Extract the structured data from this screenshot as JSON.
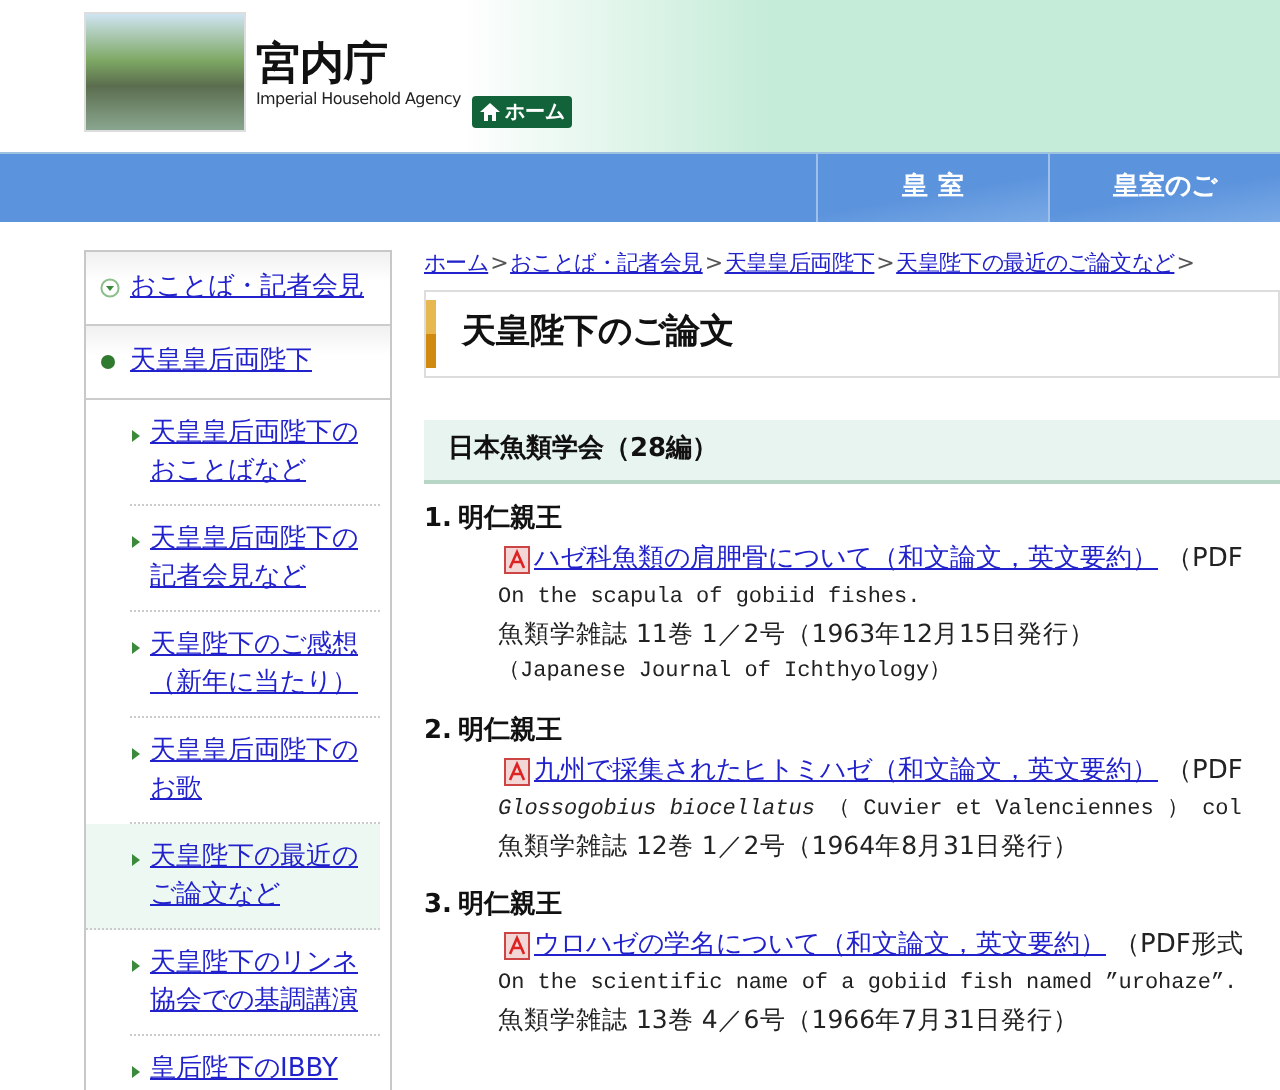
{
  "header": {
    "title_ja": "宮内庁",
    "title_en": "Imperial Household Agency",
    "home_button": "ホーム"
  },
  "nav_tabs": [
    {
      "label": "皇 室"
    },
    {
      "label": "皇室のご"
    }
  ],
  "sidebar": {
    "items": [
      {
        "label": "おことば・記者会見",
        "kind": "collapsible",
        "selected": false
      },
      {
        "label": "天皇皇后両陛下",
        "kind": "current",
        "selected": false
      },
      {
        "label": "天皇皇后両陛下のおことばなど",
        "kind": "sub",
        "selected": false
      },
      {
        "label": "天皇皇后両陛下の記者会見など",
        "kind": "sub",
        "selected": false
      },
      {
        "label": "天皇陛下のご感想（新年に当たり）",
        "kind": "sub",
        "selected": false
      },
      {
        "label": "天皇皇后両陛下のお歌",
        "kind": "sub",
        "selected": false
      },
      {
        "label": "天皇陛下の最近のご論文など",
        "kind": "sub",
        "selected": true
      },
      {
        "label": "天皇陛下のリンネ協会での基調講演",
        "kind": "sub",
        "selected": false
      },
      {
        "label": "皇后陛下のIBBY",
        "kind": "sub",
        "selected": false
      }
    ]
  },
  "breadcrumb": [
    {
      "kind": "link",
      "label": "ホーム"
    },
    {
      "kind": "separator",
      "label": ">"
    },
    {
      "kind": "link",
      "label": "おことば・記者会見"
    },
    {
      "kind": "separator",
      "label": ">"
    },
    {
      "kind": "link",
      "label": "天皇皇后両陛下"
    },
    {
      "kind": "separator",
      "label": ">"
    },
    {
      "kind": "link",
      "label": "天皇陛下の最近のご論文など"
    },
    {
      "kind": "separator",
      "label": ">"
    }
  ],
  "page_title": "天皇陛下のご論文",
  "section_title": "日本魚類学会（28編）",
  "papers": [
    {
      "number": "1.",
      "author": "明仁親王",
      "link": "ハゼ科魚類の肩胛骨について（和文論文，英文要約）",
      "format": "（PDF",
      "lines": [
        {
          "kind": "english",
          "text": "On the scapula of gobiid fishes."
        },
        {
          "kind": "journal",
          "text": "魚類学雑誌 11巻 1／2号（1963年12月15日発行）"
        },
        {
          "kind": "note",
          "text": "（Japanese Journal of Ichthyology）"
        }
      ]
    },
    {
      "number": "2.",
      "author": "明仁親王",
      "link": "九州で採集されたヒトミハゼ（和文論文，英文要約）",
      "format": "（PDF",
      "lines": [
        {
          "kind": "english",
          "text": "*Glossogobius biocellatus* （ Cuvier et Valenciennes ） col"
        },
        {
          "kind": "journal",
          "text": "魚類学雑誌 12巻 1／2号（1964年8月31日発行）"
        }
      ]
    },
    {
      "number": "3.",
      "author": "明仁親王",
      "link": "ウロハゼの学名について（和文論文，英文要約）",
      "format": "（PDF形式",
      "lines": [
        {
          "kind": "english",
          "text": "On the scientific name of a gobiid fish named ”urohaze”."
        },
        {
          "kind": "journal",
          "text": "魚類学雑誌 13巻 4／6号（1966年7月31日発行）"
        }
      ]
    }
  ]
}
